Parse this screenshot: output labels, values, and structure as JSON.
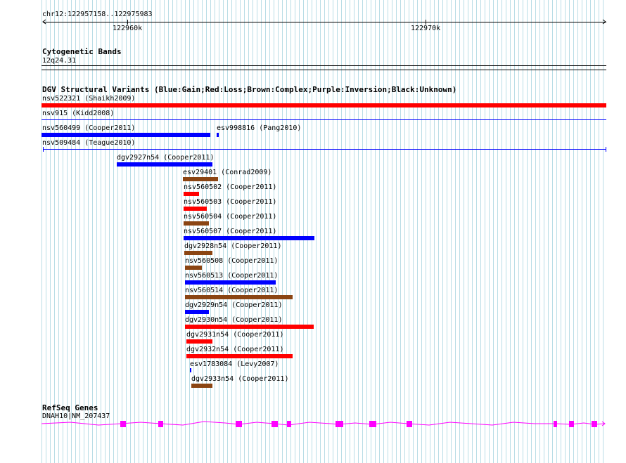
{
  "position": {
    "label": "chr12:122957158..122975983",
    "ticks": [
      "122960k",
      "122970k"
    ]
  },
  "cytoband": {
    "title": "Cytogenetic Bands",
    "band": "12q24.31"
  },
  "dgv": {
    "title": "DGV Structural Variants (Blue:Gain;Red:Loss;Brown:Complex;Purple:Inversion;Black:Unknown)",
    "colors": {
      "gain": "#0000ff",
      "loss": "#ff0000",
      "complex": "#8b4513",
      "unknown": "#000000"
    },
    "variants": [
      {
        "label": "nsv522321 (Shaikh2009)",
        "type": "loss"
      },
      {
        "label": "nsv915 (Kidd2008)",
        "type": "gain"
      },
      {
        "label": "nsv560499 (Cooper2011)",
        "type": "gain"
      },
      {
        "label": "esv998816 (Pang2010)",
        "type": "gain"
      },
      {
        "label": "nsv509484 (Teague2010)",
        "type": "gain"
      },
      {
        "label": "dgv2927n54 (Cooper2011)",
        "type": "gain"
      },
      {
        "label": "esv29401 (Conrad2009)",
        "type": "complex"
      },
      {
        "label": "nsv560502 (Cooper2011)",
        "type": "loss"
      },
      {
        "label": "nsv560503 (Cooper2011)",
        "type": "loss"
      },
      {
        "label": "nsv560504 (Cooper2011)",
        "type": "complex"
      },
      {
        "label": "nsv560507 (Cooper2011)",
        "type": "gain"
      },
      {
        "label": "dgv2928n54 (Cooper2011)",
        "type": "complex"
      },
      {
        "label": "nsv560508 (Cooper2011)",
        "type": "complex"
      },
      {
        "label": "nsv560513 (Cooper2011)",
        "type": "gain"
      },
      {
        "label": "nsv560514 (Cooper2011)",
        "type": "complex"
      },
      {
        "label": "dgv2929n54 (Cooper2011)",
        "type": "gain"
      },
      {
        "label": "dgv2930n54 (Cooper2011)",
        "type": "loss"
      },
      {
        "label": "dgv2931n54 (Cooper2011)",
        "type": "loss"
      },
      {
        "label": "dgv2932n54 (Cooper2011)",
        "type": "loss"
      },
      {
        "label": "esv1783084 (Levy2007)",
        "type": "gain"
      },
      {
        "label": "dgv2933n54 (Cooper2011)",
        "type": "complex"
      }
    ]
  },
  "refseq": {
    "title": "RefSeq Genes",
    "gene": "DNAH10|NM_207437",
    "colors": {
      "gene": "#ff00ff"
    }
  }
}
